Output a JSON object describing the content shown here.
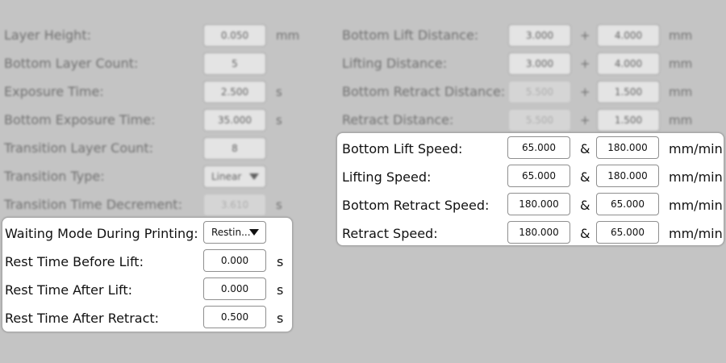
{
  "left_dimmed": [
    {
      "label": "Layer Height:",
      "value": "0.050",
      "unit": "mm",
      "disabled": false
    },
    {
      "label": "Bottom Layer Count:",
      "value": "5",
      "unit": "",
      "disabled": false
    },
    {
      "label": "Exposure Time:",
      "value": "2.500",
      "unit": "s",
      "disabled": false
    },
    {
      "label": "Bottom Exposure Time:",
      "value": "35.000",
      "unit": "s",
      "disabled": false
    },
    {
      "label": "Transition Layer Count:",
      "value": "8",
      "unit": "",
      "disabled": false
    },
    {
      "label": "Transition Type:",
      "value": "Linear",
      "unit": "",
      "disabled": false,
      "dropdown": true
    },
    {
      "label": "Transition Time Decrement:",
      "value": "3.610",
      "unit": "s",
      "disabled": true
    }
  ],
  "left_highlight": [
    {
      "label": "Waiting Mode During Printing:",
      "value": "Restin...",
      "unit": "",
      "dropdown": true
    },
    {
      "label": "Rest Time Before Lift:",
      "value": "0.000",
      "unit": "s"
    },
    {
      "label": "Rest Time After Lift:",
      "value": "0.000",
      "unit": "s"
    },
    {
      "label": "Rest Time After Retract:",
      "value": "0.500",
      "unit": "s"
    }
  ],
  "right_dimmed": [
    {
      "label": "Bottom Lift Distance:",
      "value1": "3.000",
      "sep": "+",
      "value2": "4.000",
      "unit": "mm",
      "disabled1": false
    },
    {
      "label": "Lifting Distance:",
      "value1": "3.000",
      "sep": "+",
      "value2": "4.000",
      "unit": "mm",
      "disabled1": false
    },
    {
      "label": "Bottom Retract Distance:",
      "value1": "5.500",
      "sep": "+",
      "value2": "1.500",
      "unit": "mm",
      "disabled1": true
    },
    {
      "label": "Retract Distance:",
      "value1": "5.500",
      "sep": "+",
      "value2": "1.500",
      "unit": "mm",
      "disabled1": true
    }
  ],
  "right_highlight": [
    {
      "label": "Bottom Lift Speed:",
      "value1": "65.000",
      "sep": "&",
      "value2": "180.000",
      "unit": "mm/min"
    },
    {
      "label": "Lifting Speed:",
      "value1": "65.000",
      "sep": "&",
      "value2": "180.000",
      "unit": "mm/min"
    },
    {
      "label": "Bottom Retract Speed:",
      "value1": "180.000",
      "sep": "&",
      "value2": "65.000",
      "unit": "mm/min"
    },
    {
      "label": "Retract Speed:",
      "value1": "180.000",
      "sep": "&",
      "value2": "65.000",
      "unit": "mm/min"
    }
  ],
  "colors": {
    "dim_background": "#c4c4c4",
    "panel": "#ffffff",
    "field_border": "#8f8f8f"
  },
  "icons": {
    "dropdown": "caret-down-icon"
  }
}
